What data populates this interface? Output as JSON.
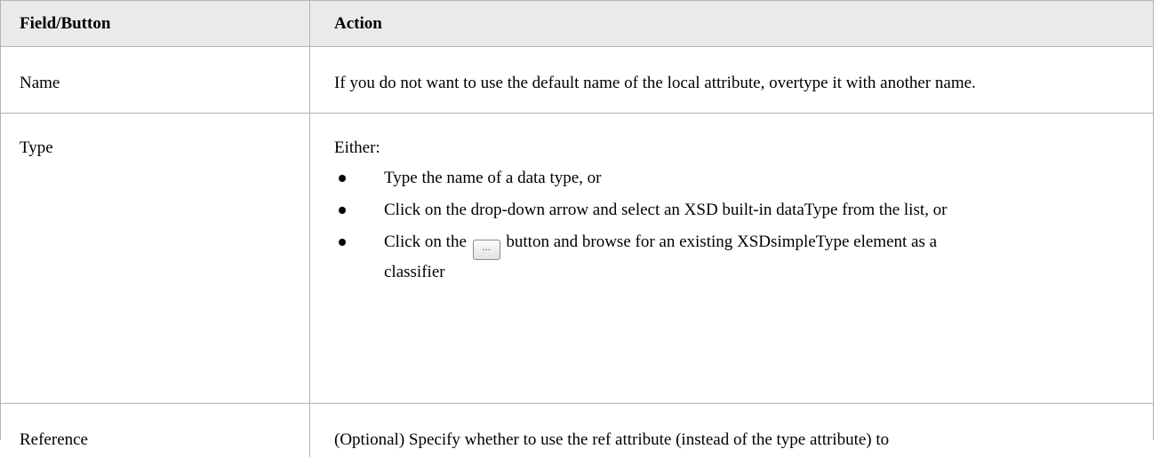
{
  "table": {
    "headers": [
      "Field/Button",
      "Action"
    ],
    "rows": [
      {
        "field": "Name",
        "action": "If you do not want to use the default name of the local attribute, overtype it with another name."
      },
      {
        "field": "Type",
        "intro": "Either:",
        "bullets": [
          "Type the name of a data type, or",
          "Click on the drop-down arrow and select an XSD built-in dataType from the list, or"
        ],
        "last_bullet": {
          "before": "Click on the",
          "button_label": "...",
          "after": "button and browse for an existing XSDsimpleType element as a classifier"
        }
      },
      {
        "field": "Reference",
        "action": "(Optional) Specify whether to use the ref attribute (instead of the type attribute) to"
      }
    ]
  }
}
